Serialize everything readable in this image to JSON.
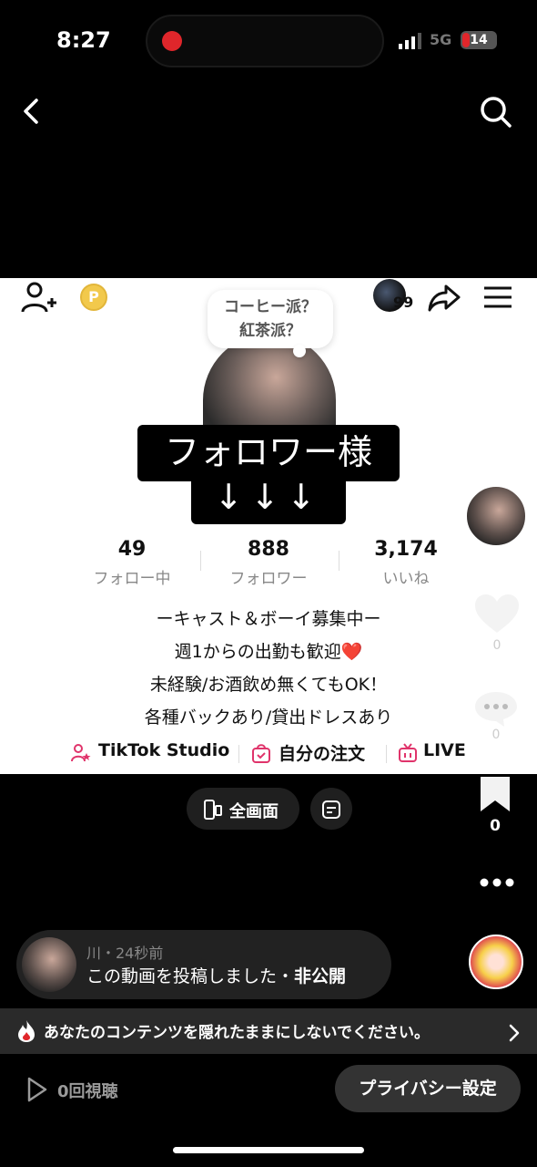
{
  "status_bar": {
    "time": "8:27",
    "network": "5G",
    "battery": "14"
  },
  "profile": {
    "coin_label": "P",
    "notification_count": "99",
    "bubble_line1": "コーヒー派？",
    "bubble_line2": "紅茶派？",
    "overlay_line1": "フォロワー様",
    "overlay_line2": "↓↓↓",
    "stats": [
      {
        "value": "49",
        "label": "フォロー中"
      },
      {
        "value": "888",
        "label": "フォロワー"
      },
      {
        "value": "3,174",
        "label": "いいね"
      }
    ],
    "bio": [
      "ーキャスト＆ボーイ募集中ー",
      "週1からの出勤も歓迎❤️",
      "未経験/お酒飲め無くてもOK！",
      "各種バックあり/貸出ドレスあり"
    ],
    "links": {
      "studio": "TikTok Studio",
      "orders": "自分の注文",
      "live": "LIVE"
    }
  },
  "rail": {
    "likes": "0",
    "comments": "0",
    "saves": "0"
  },
  "pills": {
    "fullscreen": "全画面"
  },
  "activity": {
    "meta": "川・24秒前",
    "text": "この動画を投稿しました・",
    "private": "非公開"
  },
  "banner": {
    "text": "あなたのコンテンツを隠れたままにしないでください。"
  },
  "bottom": {
    "views": "0回視聴",
    "privacy_button": "プライバシー設定"
  },
  "colors": {
    "record": "#e0262b",
    "coin": "#f2c94c",
    "studio_icon": "#e0346b"
  }
}
